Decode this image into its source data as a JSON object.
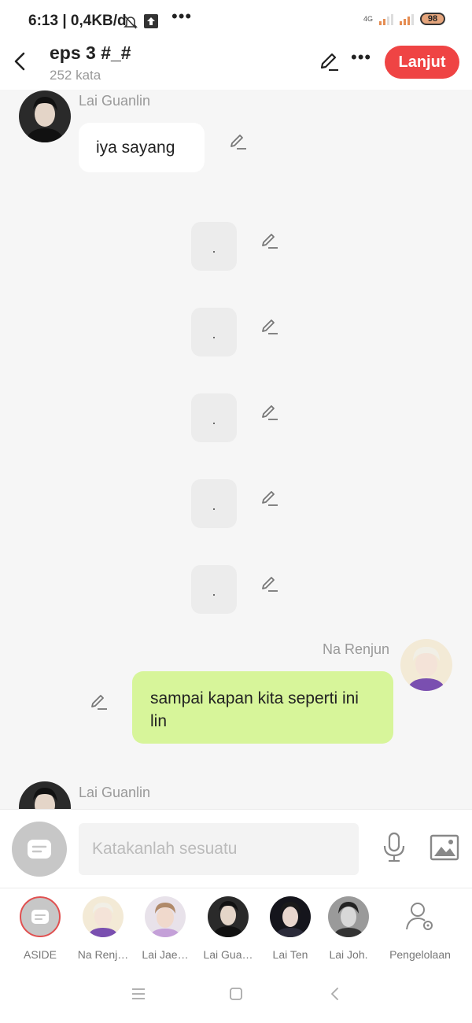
{
  "status_bar": {
    "time": "6:13",
    "net_speed": "| 0,4KB/d",
    "network_type": "4G",
    "battery": "98"
  },
  "header": {
    "title": "eps 3 #_#",
    "subtitle": "252 kata",
    "next_button": "Lanjut"
  },
  "messages": [
    {
      "speaker": "Lai Guanlin",
      "text": "iya sayang",
      "side": "left"
    },
    {
      "text": ".",
      "side": "aside"
    },
    {
      "text": ".",
      "side": "aside"
    },
    {
      "text": ".",
      "side": "aside"
    },
    {
      "text": ".",
      "side": "aside"
    },
    {
      "text": ".",
      "side": "aside"
    },
    {
      "speaker": "Na Renjun",
      "text": "sampai kapan kita seperti ini lin",
      "side": "right"
    },
    {
      "speaker": "Lai Guanlin",
      "side": "left"
    }
  ],
  "input": {
    "placeholder": "Katakanlah sesuatu"
  },
  "characters": [
    {
      "label": "ASIDE"
    },
    {
      "label": "Na Renj…"
    },
    {
      "label": "Lai Jae…"
    },
    {
      "label": "Lai Gua…"
    },
    {
      "label": "Lai Ten"
    },
    {
      "label": "Lai Joh."
    },
    {
      "label": "Pengelolaan"
    }
  ],
  "colors": {
    "accent": "#ef4444",
    "right_bubble": "#d7f59a",
    "chat_bg": "#f6f6f6"
  }
}
